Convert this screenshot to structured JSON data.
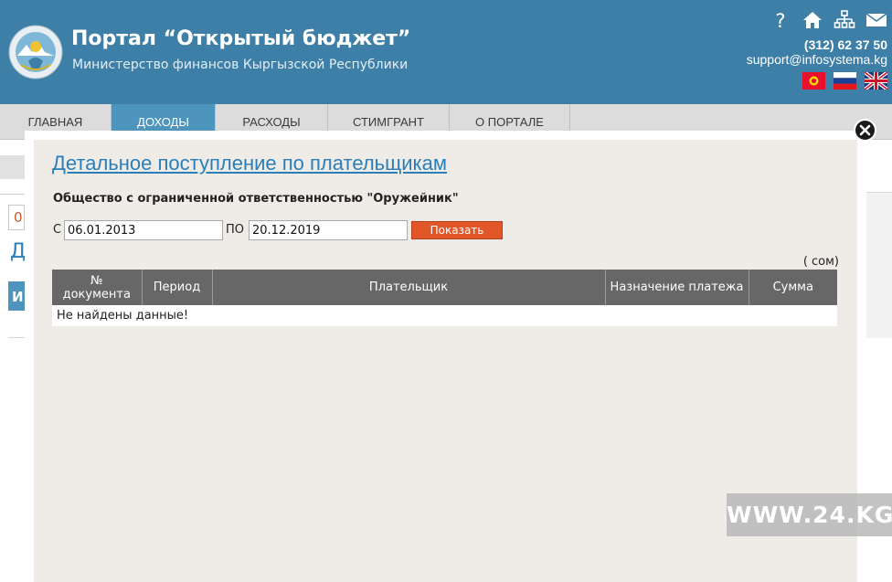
{
  "header": {
    "title": "Портал “Открытый бюджет”",
    "subtitle": "Министерство финансов Кыргызской Республики",
    "phone": "(312) 62 37 50",
    "email": "support@infosystema.kg",
    "icons": [
      "help-icon",
      "home-icon",
      "sitemap-icon",
      "mail-icon"
    ],
    "flags": [
      "kyrgyz-flag-icon",
      "russian-flag-icon",
      "uk-flag-icon"
    ]
  },
  "nav": {
    "items": [
      {
        "label": "ГЛАВНАЯ",
        "active": false
      },
      {
        "label": "ДОХОДЫ",
        "active": true
      },
      {
        "label": "РАСХОДЫ",
        "active": false
      },
      {
        "label": "СТИМГРАНТ",
        "active": false
      },
      {
        "label": "О ПОРТАЛЕ",
        "active": false
      }
    ]
  },
  "background": {
    "letter_d": "Д",
    "letter_i": "И",
    "partial_digit": "0"
  },
  "modal": {
    "title": "Детальное поступление по плательщикам",
    "org": "Общество с ограниченной ответственностью \"Оружейник\"",
    "from_label": "С",
    "from_date": "06.01.2013",
    "to_label": "ПО",
    "to_date": "20.12.2019",
    "show_button": "Показать",
    "currency": "( сом)",
    "table": {
      "headers": [
        "№ документа",
        "Период",
        "Плательщик",
        "Назначение платежа",
        "Сумма"
      ],
      "empty_message": "Не найдены данные!"
    }
  },
  "watermark": "WWW.24.KG",
  "colors": {
    "header_bg": "#3d7fa7",
    "nav_active": "#4e95bd",
    "modal_bg": "#efece7",
    "title_link": "#2a7fb8",
    "button": "#e2572a",
    "table_header": "#676767"
  }
}
